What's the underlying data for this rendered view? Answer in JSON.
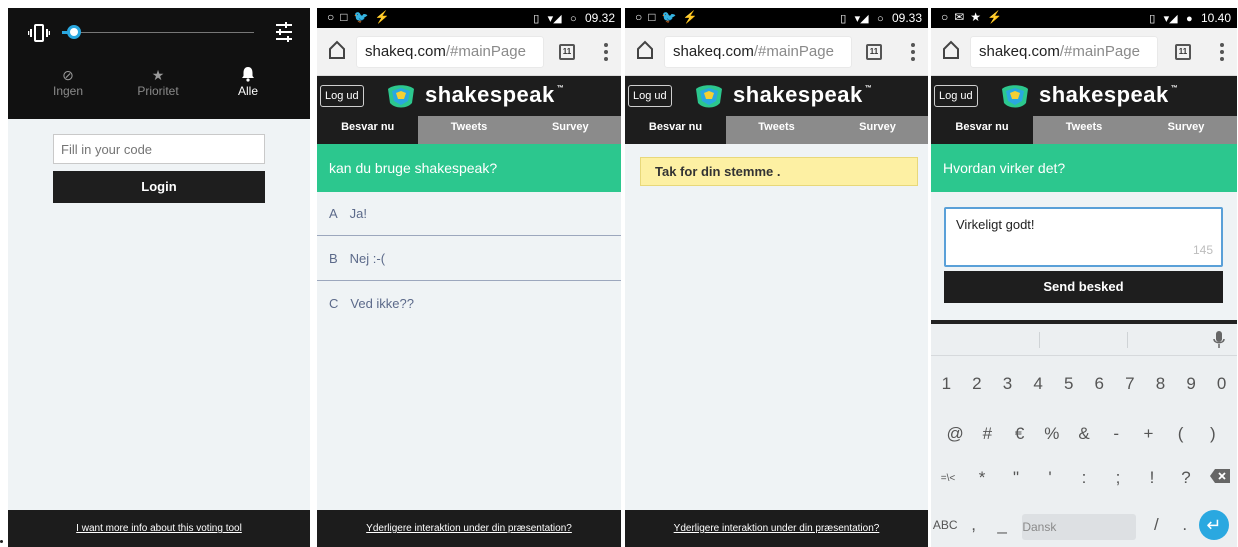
{
  "panel1": {
    "shade": {
      "modes": [
        {
          "label": "Ingen",
          "icon": "block-icon",
          "glyph": "⊘"
        },
        {
          "label": "Prioritet",
          "icon": "star-icon",
          "glyph": "★"
        },
        {
          "label": "Alle",
          "icon": "bell-icon",
          "glyph": "🔔"
        }
      ],
      "slider_level": 0.06
    },
    "code_placeholder": "Fill in your code",
    "login_label": "Login",
    "footer": "I want more info about this voting tool"
  },
  "panel2": {
    "status_time": "09.32",
    "url_host": "shakeq.com",
    "url_path": "/#mainPage",
    "tab_count": "11",
    "logout": "Log ud",
    "brand": "shakespeak",
    "tm": "™",
    "tabs": [
      "Besvar nu",
      "Tweets",
      "Survey"
    ],
    "question": "kan du bruge shakespeak?",
    "options": [
      {
        "letter": "A",
        "text": "Ja!"
      },
      {
        "letter": "B",
        "text": "Nej :-("
      },
      {
        "letter": "C",
        "text": "Ved ikke??"
      }
    ],
    "footer": "Yderligere interaktion under din præsentation?"
  },
  "panel3": {
    "status_time": "09.33",
    "url_host": "shakeq.com",
    "url_path": "/#mainPage",
    "tab_count": "11",
    "logout": "Log ud",
    "brand": "shakespeak",
    "tm": "™",
    "tabs": [
      "Besvar nu",
      "Tweets",
      "Survey"
    ],
    "notice": "Tak for din stemme .",
    "footer": "Yderligere interaktion under din præsentation?"
  },
  "panel4": {
    "status_time": "10.40",
    "url_host": "shakeq.com",
    "url_path": "/#mainPage",
    "tab_count": "11",
    "logout": "Log ud",
    "brand": "shakespeak",
    "tm": "™",
    "tabs": [
      "Besvar nu",
      "Tweets",
      "Survey"
    ],
    "question": "Hvordan virker det?",
    "answer": "Virkeligt godt!",
    "char_count": "145",
    "send_label": "Send besked",
    "keyboard": {
      "row1": [
        "1",
        "2",
        "3",
        "4",
        "5",
        "6",
        "7",
        "8",
        "9",
        "0"
      ],
      "row2": [
        "@",
        "#",
        "€",
        "%",
        "&",
        "-",
        "+",
        "(",
        ")"
      ],
      "row3": [
        "=\\<",
        "*",
        "\"",
        "'",
        ":",
        ";",
        "!",
        "?"
      ],
      "abc": "ABC",
      "comma": ",",
      "underscore": "_",
      "space": "Dansk",
      "slash": "/",
      "period": "."
    }
  },
  "colors": {
    "accent_green": "#2cc78e",
    "accent_blue": "#2aa8e0",
    "header_dark": "#1d1d1d",
    "tab_gray": "#8b8b8b",
    "notice_yellow": "#fdf0a3"
  }
}
